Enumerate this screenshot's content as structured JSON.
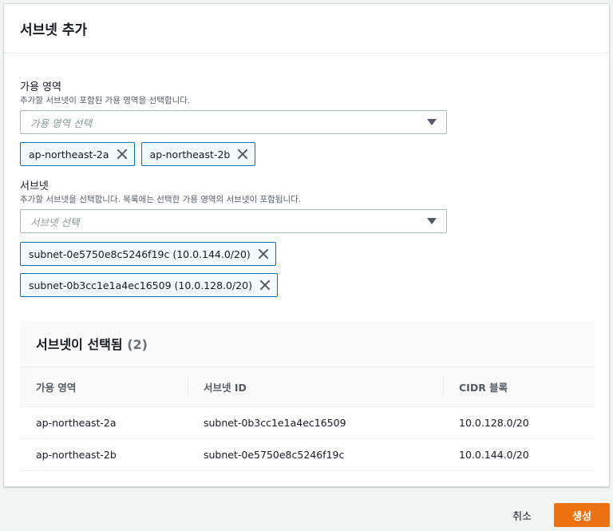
{
  "panel": {
    "title": "서브넷 추가"
  },
  "availability_zone": {
    "label": "가용 영역",
    "description": "추가할 서브넷이 포함된 가용 영역을 선택합니다.",
    "placeholder": "가용 영역 선택",
    "tokens": [
      "ap-northeast-2a",
      "ap-northeast-2b"
    ]
  },
  "subnet": {
    "label": "서브넷",
    "description": "추가할 서브넷을 선택합니다. 목록에는 선택한 가용 영역의 서브넷이 포함됩니다.",
    "placeholder": "서브넷 선택",
    "tokens": [
      "subnet-0e5750e8c5246f19c (10.0.144.0/20)",
      "subnet-0b3cc1e1a4ec16509 (10.0.128.0/20)"
    ]
  },
  "selected_table": {
    "title": "서브넷이 선택됨",
    "count": "(2)",
    "columns": [
      "가용 영역",
      "서브넷 ID",
      "CIDR 블록"
    ],
    "rows": [
      [
        "ap-northeast-2a",
        "subnet-0b3cc1e1a4ec16509",
        "10.0.128.0/20"
      ],
      [
        "ap-northeast-2b",
        "subnet-0e5750e8c5246f19c",
        "10.0.144.0/20"
      ]
    ]
  },
  "actions": {
    "cancel": "취소",
    "create": "생성"
  },
  "icons": {
    "dropdown": "caret-down-icon",
    "remove": "close-icon"
  },
  "colors": {
    "accent": "#0073bb",
    "primary_button": "#ec7211",
    "token_bg": "#f1faff"
  }
}
